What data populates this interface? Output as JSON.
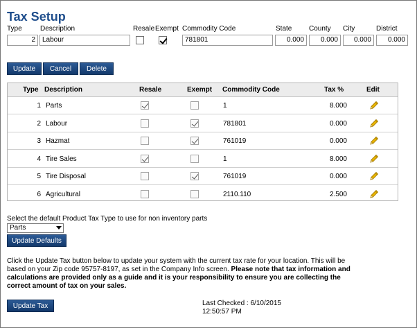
{
  "page": {
    "title": "Tax Setup"
  },
  "form": {
    "labels": {
      "type": "Type",
      "description": "Description",
      "resale": "Resale",
      "exempt": "Exempt",
      "commodity_code": "Commodity Code",
      "state": "State",
      "county": "County",
      "city": "City",
      "district": "District"
    },
    "type": "2",
    "description": "Labour",
    "resale": false,
    "exempt": true,
    "commodity_code": "781801",
    "state": "0.000",
    "county": "0.000",
    "city": "0.000",
    "district": "0.000"
  },
  "actions": {
    "update": "Update",
    "cancel": "Cancel",
    "delete": "Delete"
  },
  "table": {
    "headers": {
      "type": "Type",
      "description": "Description",
      "resale": "Resale",
      "exempt": "Exempt",
      "commodity_code": "Commodity Code",
      "tax": "Tax %",
      "edit": "Edit"
    },
    "rows": [
      {
        "type": "1",
        "description": "Parts",
        "resale": true,
        "exempt": false,
        "commodity_code": "1",
        "tax": "8.000"
      },
      {
        "type": "2",
        "description": "Labour",
        "resale": false,
        "exempt": true,
        "commodity_code": "781801",
        "tax": "0.000"
      },
      {
        "type": "3",
        "description": "Hazmat",
        "resale": false,
        "exempt": true,
        "commodity_code": "761019",
        "tax": "0.000"
      },
      {
        "type": "4",
        "description": "Tire Sales",
        "resale": true,
        "exempt": false,
        "commodity_code": "1",
        "tax": "8.000"
      },
      {
        "type": "5",
        "description": "Tire Disposal",
        "resale": false,
        "exempt": true,
        "commodity_code": "761019",
        "tax": "0.000"
      },
      {
        "type": "6",
        "description": "Agricultural",
        "resale": false,
        "exempt": false,
        "commodity_code": "2110.110",
        "tax": "2.500"
      }
    ],
    "edit_icon": "pencil-icon"
  },
  "defaults": {
    "prompt": "Select the default Product Tax Type to use for non inventory parts",
    "selected": "Parts",
    "button": "Update Defaults"
  },
  "info": {
    "text_plain": "Click the Update Tax button below to update your system with the current tax rate for your location. This will be based on your Zip code 95757-8197, as set in the Company Info screen. ",
    "text_bold": "Please note that tax information and calculations are provided only as a guide and it is your responsibility to ensure you are collecting the correct amount of tax on your sales."
  },
  "update_tax": {
    "button": "Update Tax",
    "last_checked_label": "Last Checked : 6/10/2015",
    "last_checked_time": "12:50:57 PM"
  },
  "colors": {
    "title": "#1f4e8c",
    "button": "#1d4a82",
    "pencil": "#e8b400"
  }
}
